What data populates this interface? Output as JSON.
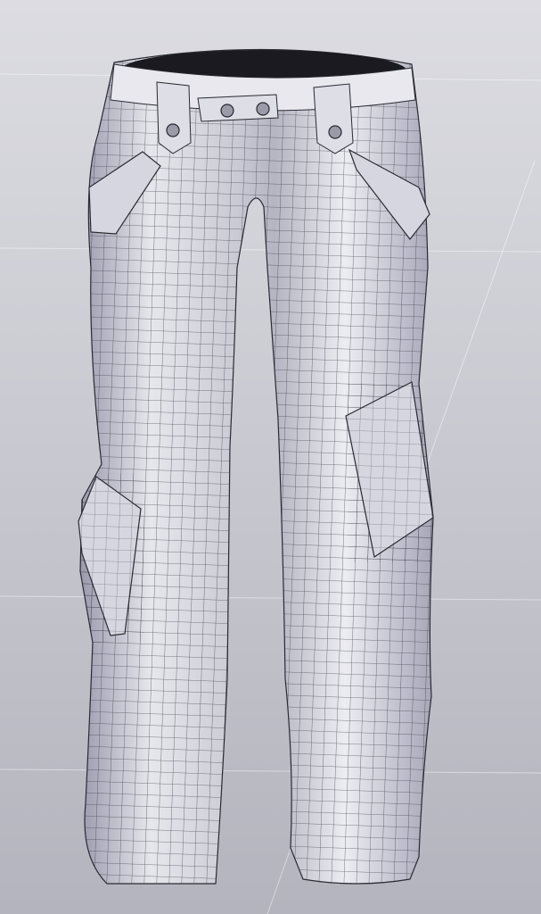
{
  "colors": {
    "background_top": "#dcdce2",
    "background_bottom": "#b4b4be",
    "mesh_light": "#f2f2f6",
    "mesh_shadow": "#9a9aae",
    "wire": "#2a2a33",
    "waist_inner": "#1a1a20"
  }
}
